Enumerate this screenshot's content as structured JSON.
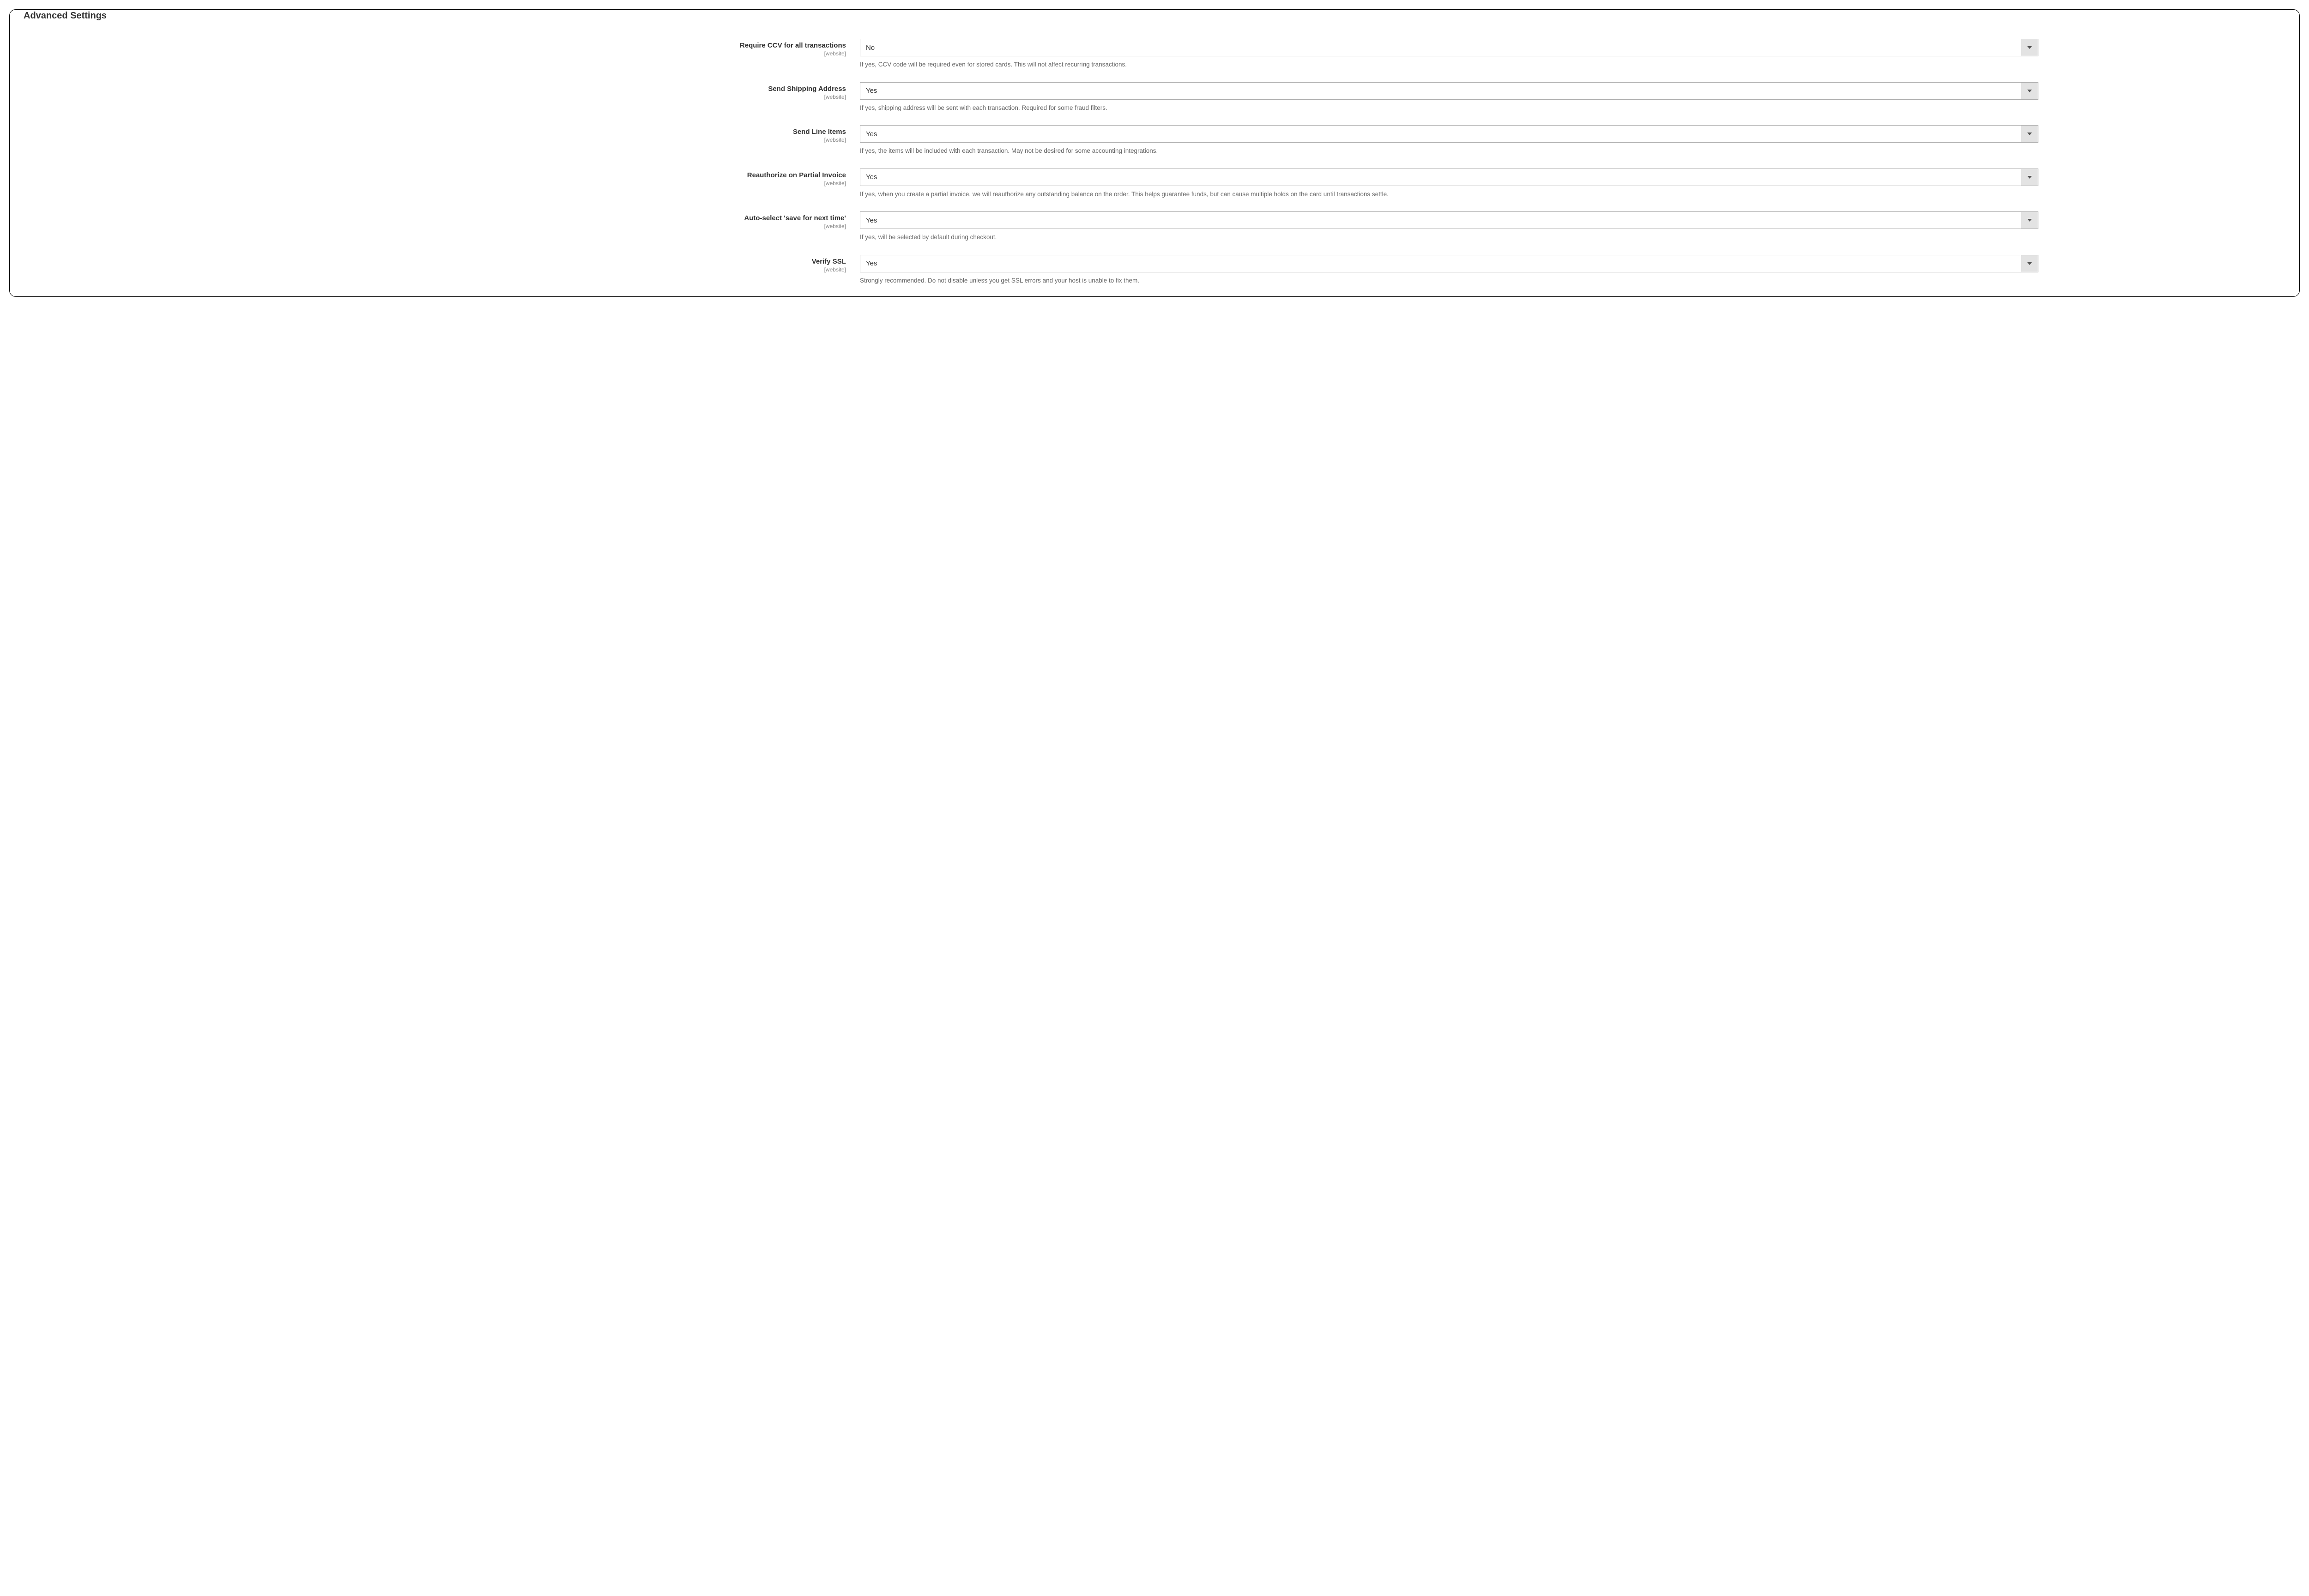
{
  "sectionTitle": "Advanced Settings",
  "scopeLabel": "[website]",
  "fields": {
    "requireCcv": {
      "label": "Require CCV for all transactions",
      "value": "No",
      "help": "If yes, CCV code will be required even for stored cards. This will not affect recurring transactions."
    },
    "sendShipping": {
      "label": "Send Shipping Address",
      "value": "Yes",
      "help": "If yes, shipping address will be sent with each transaction. Required for some fraud filters."
    },
    "sendLineItems": {
      "label": "Send Line Items",
      "value": "Yes",
      "help": "If yes, the items will be included with each transaction. May not be desired for some accounting integrations."
    },
    "reauthorize": {
      "label": "Reauthorize on Partial Invoice",
      "value": "Yes",
      "help": "If yes, when you create a partial invoice, we will reauthorize any outstanding balance on the order. This helps guarantee funds, but can cause multiple holds on the card until transactions settle."
    },
    "autoSave": {
      "label": "Auto-select 'save for next time'",
      "value": "Yes",
      "help": "If yes, will be selected by default during checkout."
    },
    "verifySsl": {
      "label": "Verify SSL",
      "value": "Yes",
      "help": "Strongly recommended. Do not disable unless you get SSL errors and your host is unable to fix them."
    }
  }
}
